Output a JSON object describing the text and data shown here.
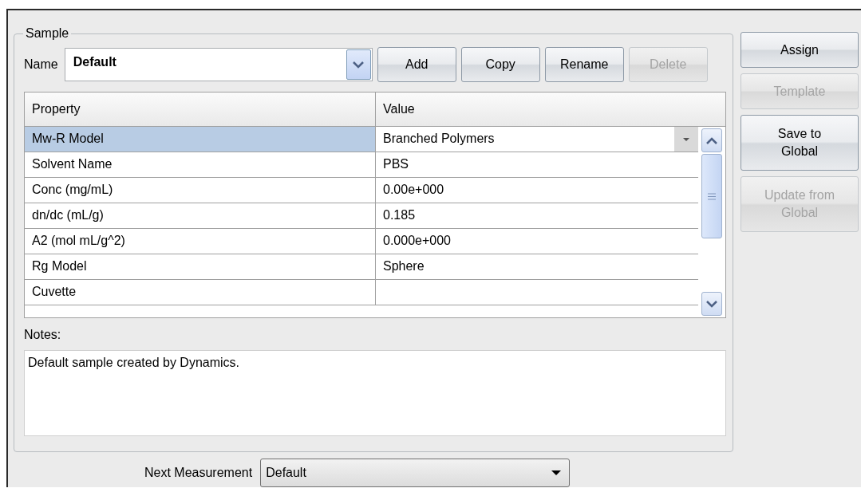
{
  "group": {
    "title": "Sample"
  },
  "name_field": {
    "label": "Name",
    "value": "Default"
  },
  "buttons": [
    {
      "label": "Add",
      "disabled": false
    },
    {
      "label": "Copy",
      "disabled": false
    },
    {
      "label": "Rename",
      "disabled": false
    },
    {
      "label": "Delete",
      "disabled": true
    }
  ],
  "table": {
    "columns": [
      "Property",
      "Value"
    ],
    "rows": [
      {
        "property": "Mw-R Model",
        "value": "Branched Polymers",
        "selected": true,
        "kind": "dropdown"
      },
      {
        "property": "Solvent Name",
        "value": "PBS",
        "selected": false,
        "kind": "text"
      },
      {
        "property": "Conc (mg/mL)",
        "value": "0.00e+000",
        "selected": false,
        "kind": "text"
      },
      {
        "property": "dn/dc (mL/g)",
        "value": "0.185",
        "selected": false,
        "kind": "text"
      },
      {
        "property": "A2 (mol mL/g^2)",
        "value": "0.000e+000",
        "selected": false,
        "kind": "text"
      },
      {
        "property": "Rg Model",
        "value": "Sphere",
        "selected": false,
        "kind": "text"
      },
      {
        "property": "Cuvette",
        "selected": false,
        "kind": "text"
      }
    ]
  },
  "notes": {
    "label": "Notes:",
    "value": "Default sample created by Dynamics."
  },
  "side_buttons": [
    {
      "label": "Assign",
      "disabled": false
    },
    {
      "label": "Template",
      "disabled": true
    },
    {
      "label": "Save to Global",
      "disabled": false
    },
    {
      "label": "Update from Global",
      "disabled": true
    }
  ],
  "next_measurement": {
    "label": "Next Measurement",
    "value": "Default"
  }
}
